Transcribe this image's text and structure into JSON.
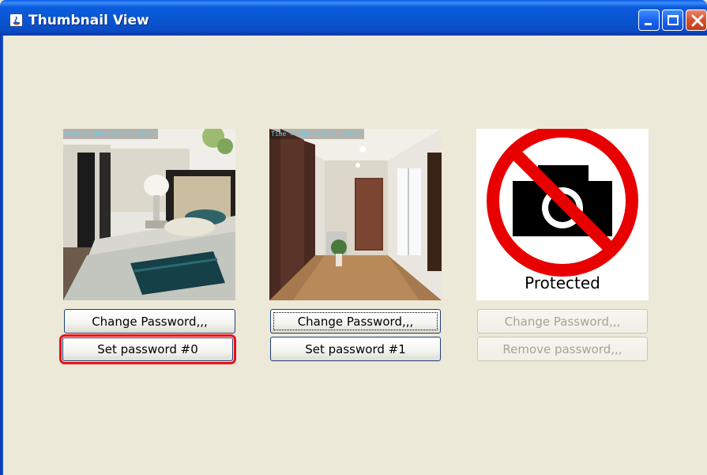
{
  "window": {
    "title": "Thumbnail View"
  },
  "thumbnails": [
    {
      "overlay": "Time = 209 Zoom x1 Ver S",
      "kind": "bedroom-photo",
      "primary_button": "Change Password,,,",
      "secondary_button": "Set password #0",
      "enabled": true,
      "highlighted": "secondary"
    },
    {
      "overlay": "Time = 209 Zoom x1 Ver S",
      "kind": "hallway-photo",
      "primary_button": "Change Password,,,",
      "secondary_button": "Set password #1",
      "enabled": true,
      "focused": "primary"
    },
    {
      "kind": "no-camera-sign",
      "label": "Protected",
      "primary_button": "Change Password,,,",
      "secondary_button": "Remove password,,,",
      "enabled": false
    }
  ],
  "colors": {
    "background": "#ece9d8",
    "titlebar": "#0a54d0",
    "highlight": "#e8101a",
    "prohibit_red": "#e80000"
  }
}
